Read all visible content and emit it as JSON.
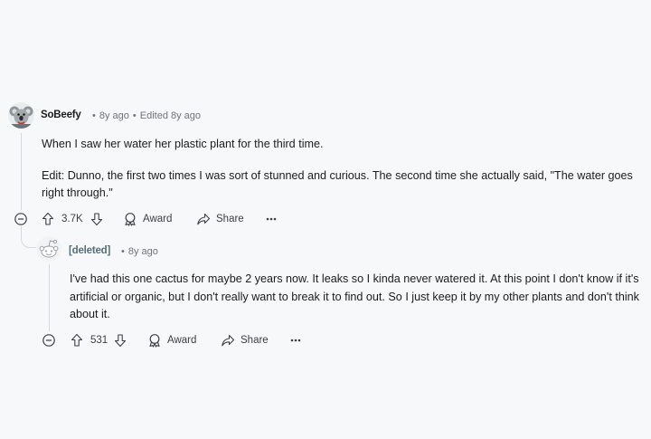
{
  "comments": [
    {
      "author": "SoBeefy",
      "time": "8y ago",
      "edited": "Edited 8y ago",
      "paragraphs": [
        "When I saw her water her plastic plant for the third time.",
        "Edit: Dunno, the first two times I was sort of stunned and curious. The second time she actually said, \"The water goes right through.\""
      ],
      "votes": "3.7K",
      "award_label": "Award",
      "share_label": "Share"
    },
    {
      "author": "[deleted]",
      "time": "8y ago",
      "paragraphs": [
        "I've had this one cactus for maybe 2 years now. It leaks so I kinda never watered it. At this point I don't know if it's artificial or organic, but I don't really want to break it to find out. So I just keep it by my other plants and don't think about it."
      ],
      "votes": "531",
      "award_label": "Award",
      "share_label": "Share"
    }
  ],
  "icons": {
    "collapse": "minus-circle-icon",
    "upvote": "arrow-up-icon",
    "downvote": "arrow-down-icon",
    "award": "award-icon",
    "share": "share-icon",
    "more": "more-horizontal-icon"
  }
}
